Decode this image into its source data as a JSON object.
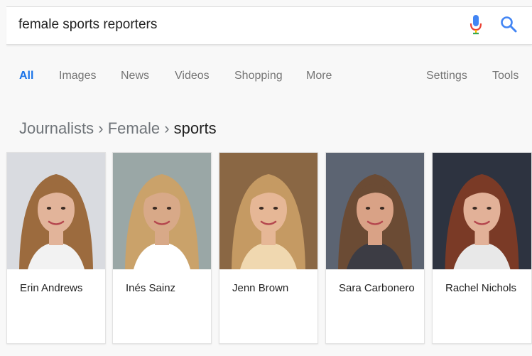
{
  "search": {
    "query": "female sports reporters"
  },
  "tabs": [
    {
      "label": "All"
    },
    {
      "label": "Images"
    },
    {
      "label": "News"
    },
    {
      "label": "Videos"
    },
    {
      "label": "Shopping"
    },
    {
      "label": "More"
    },
    {
      "label": "Settings"
    },
    {
      "label": "Tools"
    }
  ],
  "breadcrumb": {
    "part1": "Journalists",
    "sep1": "›",
    "part2": "Female",
    "sep2": "›",
    "current": "sports"
  },
  "cards": [
    {
      "name": "Erin Andrews",
      "hair": "#9c6b3e",
      "skin": "#e2b49a",
      "bg": "#d9dbe0",
      "shirt": "#f2f2f2"
    },
    {
      "name": "Inés Sainz",
      "hair": "#caa26a",
      "skin": "#d8a988",
      "bg": "#9aa7a6",
      "shirt": "#ffffff"
    },
    {
      "name": "Jenn Brown",
      "hair": "#c59a63",
      "skin": "#e6b796",
      "bg": "#8a6744",
      "shirt": "#f0d8b0"
    },
    {
      "name": "Sara Carbonero",
      "hair": "#6b4b34",
      "skin": "#d9a286",
      "bg": "#5c6472",
      "shirt": "#3c3c44"
    },
    {
      "name": "Rachel Nichols",
      "hair": "#7a3a26",
      "skin": "#e2b198",
      "bg": "#2d3340",
      "shirt": "#e8e8e8"
    }
  ],
  "colors": {
    "accent": "#1a73e8",
    "tab_text": "#757575",
    "breadcrumb": "#70757a"
  },
  "icons": {
    "voice": "mic-icon",
    "search": "search-icon"
  }
}
